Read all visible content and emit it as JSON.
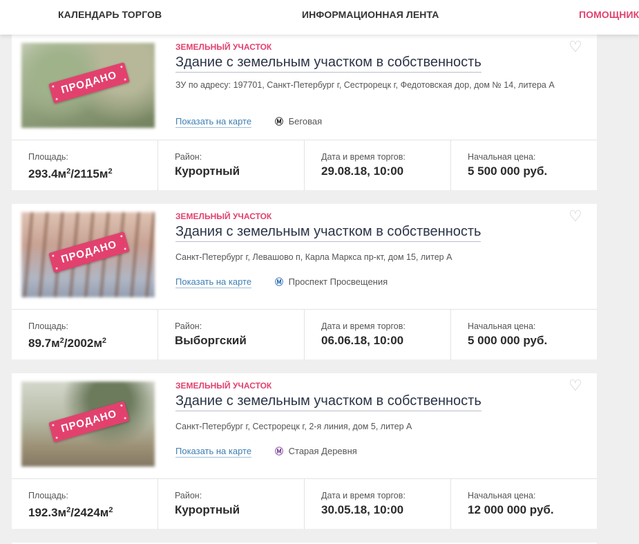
{
  "nav": {
    "calendar": "КАЛЕНДАРЬ ТОРГОВ",
    "feed": "ИНФОРМАЦИОННАЯ ЛЕНТА",
    "helper": "ПОМОЩНИК"
  },
  "colors": {
    "accent": "#e2416e",
    "link": "#3e7fb3",
    "metro_red": "#1e1e1e",
    "metro_blue": "#2c6fb5",
    "metro_purple": "#7b3f98"
  },
  "listings": [
    {
      "type": "ЗЕМЕЛЬНЫЙ УЧАСТОК",
      "title": "Здание с земельным участком в собственность",
      "address": "ЗУ по адресу: 197701, Санкт-Петербург г, Сестрорецк г, Федотовская дор, дом № 14, литера А",
      "sold_label": "ПРОДАНО",
      "map_link": "Показать на карте",
      "metro": "Беговая",
      "metro_icon": "metro-icon",
      "area_label": "Площадь:",
      "area_building": "293.4м",
      "area_land": "/2115м",
      "area_sup": "2",
      "district_label": "Район:",
      "district": "Курортный",
      "date_label": "Дата и время торгов:",
      "date": "29.08.18, 10:00",
      "price_label": "Начальная цена:",
      "price": "5 500 000 руб."
    },
    {
      "type": "ЗЕМЕЛЬНЫЙ УЧАСТОК",
      "title": "Здания с земельным участком в собственность",
      "address": "Санкт-Петербург г, Левашово п, Карла Маркса пр-кт, дом 15, литер А",
      "sold_label": "ПРОДАНО",
      "map_link": "Показать на карте",
      "metro": "Проспект Просвещения",
      "metro_icon": "metro-icon",
      "area_label": "Площадь:",
      "area_building": "89.7м",
      "area_land": "/2002м",
      "area_sup": "2",
      "district_label": "Район:",
      "district": "Выборгский",
      "date_label": "Дата и время торгов:",
      "date": "06.06.18, 10:00",
      "price_label": "Начальная цена:",
      "price": "5 000 000 руб."
    },
    {
      "type": "ЗЕМЕЛЬНЫЙ УЧАСТОК",
      "title": "Здание с земельным участком в собственность",
      "address": "Санкт-Петербург г, Сестрорецк г, 2-я линия, дом 5, литер А",
      "sold_label": "ПРОДАНО",
      "map_link": "Показать на карте",
      "metro": "Старая Деревня",
      "metro_icon": "metro-icon",
      "area_label": "Площадь:",
      "area_building": "192.3м",
      "area_land": "/2424м",
      "area_sup": "2",
      "district_label": "Район:",
      "district": "Курортный",
      "date_label": "Дата и время торгов:",
      "date": "30.05.18, 10:00",
      "price_label": "Начальная цена:",
      "price": "12 000 000 руб."
    }
  ]
}
